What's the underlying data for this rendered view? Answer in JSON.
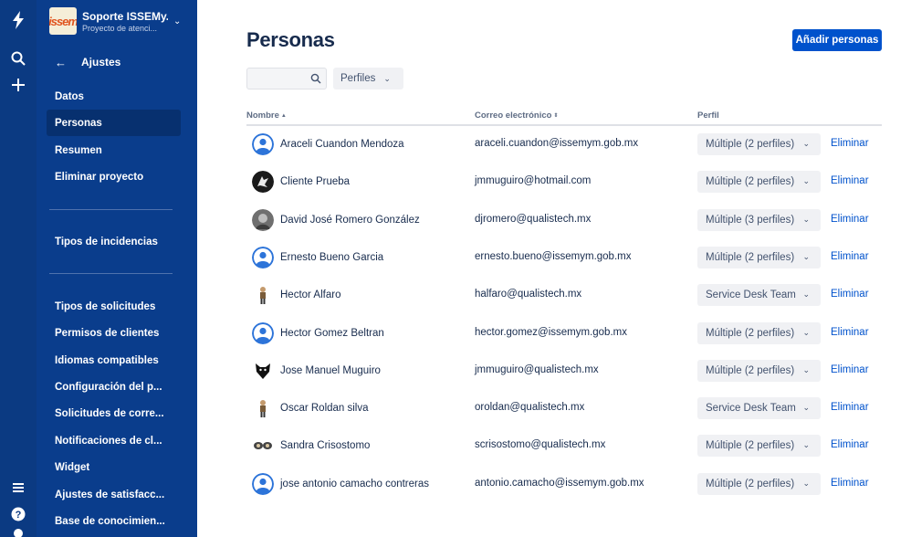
{
  "project": {
    "name": "Soporte ISSEMy...",
    "subtitle": "Proyecto de atenci...",
    "logo_text": "issem"
  },
  "settings_back": {
    "label": "Ajustes"
  },
  "sidebar": {
    "items": [
      {
        "label": "Datos"
      },
      {
        "label": "Personas"
      },
      {
        "label": "Resumen"
      },
      {
        "label": "Eliminar proyecto"
      },
      {
        "label": "Tipos de incidencias"
      },
      {
        "label": "Tipos de solicitudes"
      },
      {
        "label": "Permisos de clientes"
      },
      {
        "label": "Idiomas compatibles"
      },
      {
        "label": "Configuración del p..."
      },
      {
        "label": "Solicitudes de corre..."
      },
      {
        "label": "Notificaciones de cl..."
      },
      {
        "label": "Widget"
      },
      {
        "label": "Ajustes de satisfacc..."
      },
      {
        "label": "Base de conocimien..."
      }
    ],
    "active": "Personas"
  },
  "page": {
    "title": "Personas",
    "add_button": "Añadir personas"
  },
  "filters": {
    "search_value": "",
    "search_placeholder": "",
    "profiles_label": "Perfiles"
  },
  "table": {
    "headers": {
      "name": "Nombre",
      "email": "Correo electrónico",
      "profile": "Perfil"
    },
    "rows": [
      {
        "name": "Araceli Cuandon Mendoza",
        "email": "araceli.cuandon@issemym.gob.mx",
        "profile": "Múltiple (2 perfiles)",
        "action": "Eliminar",
        "avatar": "default-user-avatar"
      },
      {
        "name": "Cliente Prueba",
        "email": "jmmuguiro@hotmail.com",
        "profile": "Múltiple (2 perfiles)",
        "action": "Eliminar",
        "avatar": "dark-photo-avatar"
      },
      {
        "name": "David José Romero González",
        "email": "djromero@qualistech.mx",
        "profile": "Múltiple (3 perfiles)",
        "action": "Eliminar",
        "avatar": "gray-photo-avatar"
      },
      {
        "name": "Ernesto Bueno Garcia",
        "email": "ernesto.bueno@issemym.gob.mx",
        "profile": "Múltiple (2 perfiles)",
        "action": "Eliminar",
        "avatar": "default-user-avatar"
      },
      {
        "name": "Hector Alfaro",
        "email": "halfaro@qualistech.mx",
        "profile": "Service Desk Team",
        "action": "Eliminar",
        "avatar": "figure-avatar"
      },
      {
        "name": "Hector Gomez Beltran",
        "email": "hector.gomez@issemym.gob.mx",
        "profile": "Múltiple (2 perfiles)",
        "action": "Eliminar",
        "avatar": "default-user-avatar"
      },
      {
        "name": "Jose Manuel Muguiro",
        "email": "jmmuguiro@qualistech.mx",
        "profile": "Múltiple (2 perfiles)",
        "action": "Eliminar",
        "avatar": "wolf-avatar"
      },
      {
        "name": "Oscar Roldan silva",
        "email": "oroldan@qualistech.mx",
        "profile": "Service Desk Team",
        "action": "Eliminar",
        "avatar": "figure-avatar"
      },
      {
        "name": "Sandra Crisostomo",
        "email": "scrisostomo@qualistech.mx",
        "profile": "Múltiple (2 perfiles)",
        "action": "Eliminar",
        "avatar": "pair-avatar"
      },
      {
        "name": "jose antonio camacho contreras",
        "email": "antonio.camacho@issemym.gob.mx",
        "profile": "Múltiple (2 perfiles)",
        "action": "Eliminar",
        "avatar": "default-user-avatar"
      }
    ]
  },
  "global_nav": {
    "icons": [
      "jira-logo-icon",
      "search-icon",
      "create-plus-icon",
      "menu-icon",
      "help-icon"
    ]
  },
  "colors": {
    "sidebar_bg": "#0a3d8c",
    "accent": "#0052cc",
    "link": "#0052cc"
  }
}
